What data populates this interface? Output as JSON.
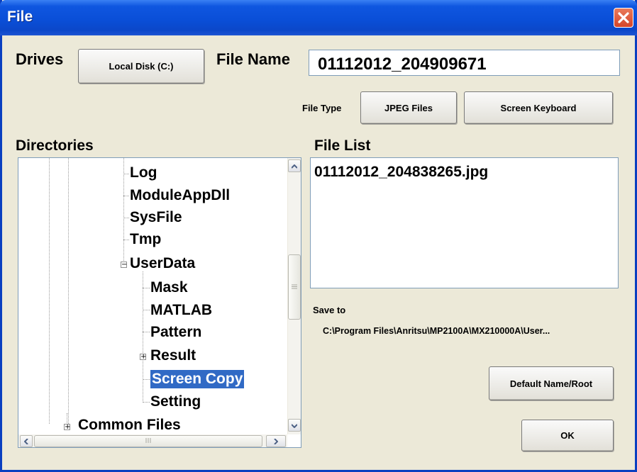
{
  "window": {
    "title": "File",
    "close_icon": "close-x-icon"
  },
  "drives": {
    "label": "Drives",
    "selected": "Local Disk (C:)"
  },
  "file_name": {
    "label": "File Name",
    "value": "01112012_204909671"
  },
  "file_type": {
    "label": "File Type",
    "selected": "JPEG Files"
  },
  "buttons": {
    "screen_keyboard": "Screen Keyboard",
    "default_name_root": "Default Name/Root",
    "ok": "OK"
  },
  "directories": {
    "label": "Directories",
    "items": [
      {
        "label": "Log",
        "expander": ""
      },
      {
        "label": "ModuleAppDll",
        "expander": ""
      },
      {
        "label": "SysFile",
        "expander": ""
      },
      {
        "label": "Tmp",
        "expander": ""
      },
      {
        "label": "UserData",
        "expander": "−"
      },
      {
        "label": "Mask",
        "expander": ""
      },
      {
        "label": "MATLAB",
        "expander": ""
      },
      {
        "label": "Pattern",
        "expander": ""
      },
      {
        "label": "Result",
        "expander": "+"
      },
      {
        "label": "Screen Copy",
        "expander": "",
        "selected": true
      },
      {
        "label": "Setting",
        "expander": ""
      },
      {
        "label": "Common Files",
        "expander": "+"
      }
    ]
  },
  "file_list": {
    "label": "File List",
    "files": [
      "01112012_204838265.jpg"
    ]
  },
  "save_to": {
    "label": "Save to",
    "path": "C:\\Program Files\\Anritsu\\MP2100A\\MX210000A\\User..."
  },
  "colors": {
    "title_bar": "#0a4fd8",
    "dialog_bg": "#ece9d8",
    "selection": "#316ac5",
    "close_button": "#d5452a"
  }
}
